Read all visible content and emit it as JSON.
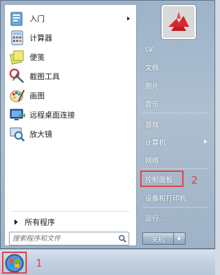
{
  "programs": [
    {
      "label": "入门",
      "icon": "getting-started-icon",
      "has_submenu": true
    },
    {
      "label": "计算器",
      "icon": "calculator-icon",
      "has_submenu": false
    },
    {
      "label": "便笺",
      "icon": "sticky-notes-icon",
      "has_submenu": false
    },
    {
      "label": "截图工具",
      "icon": "snipping-tool-icon",
      "has_submenu": false
    },
    {
      "label": "画图",
      "icon": "paint-icon",
      "has_submenu": false
    },
    {
      "label": "远程桌面连接",
      "icon": "remote-desktop-icon",
      "has_submenu": false
    },
    {
      "label": "放大镜",
      "icon": "magnifier-icon",
      "has_submenu": false
    }
  ],
  "all_programs": "所有程序",
  "search": {
    "placeholder": "搜索程序和文件"
  },
  "right_items": [
    {
      "label": "LV"
    },
    {
      "label": "文档"
    },
    {
      "label": "图片"
    },
    {
      "label": "音乐"
    },
    {
      "label": "游戏"
    },
    {
      "label": "计算机",
      "has_submenu": true
    },
    {
      "label": "网络"
    },
    {
      "label": "控制面板"
    },
    {
      "label": "设备和打印机"
    },
    {
      "label": "运行..."
    }
  ],
  "shutdown_label": "关机",
  "callouts": {
    "start": "1",
    "control_panel": "2"
  },
  "colors": {
    "highlight": "#e0424a"
  }
}
